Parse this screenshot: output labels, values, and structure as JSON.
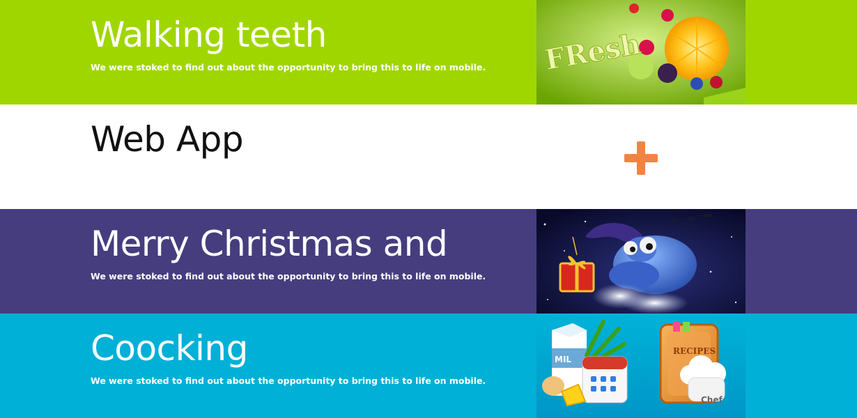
{
  "items": [
    {
      "title": "Walking teeth",
      "desc": "We were stoked to find out about the opportunity to bring this to life on mobile.",
      "bg": "#a0d600",
      "thumb_text": "FResh"
    },
    {
      "title": "Web App",
      "bg": "#ffffff",
      "accent": "#f28443",
      "expand_icon": "plus-icon"
    },
    {
      "title": "Merry Christmas and",
      "desc": "We were stoked to find out about the opportunity to bring this to life on mobile.",
      "bg": "#463d7f"
    },
    {
      "title": "Coocking",
      "desc": "We were stoked to find out about the opportunity to bring this to life on mobile.",
      "bg": "#00b0d6",
      "thumb_labels": {
        "milk": "MIL",
        "book": "RECIPES",
        "hat": "Chef"
      }
    }
  ]
}
